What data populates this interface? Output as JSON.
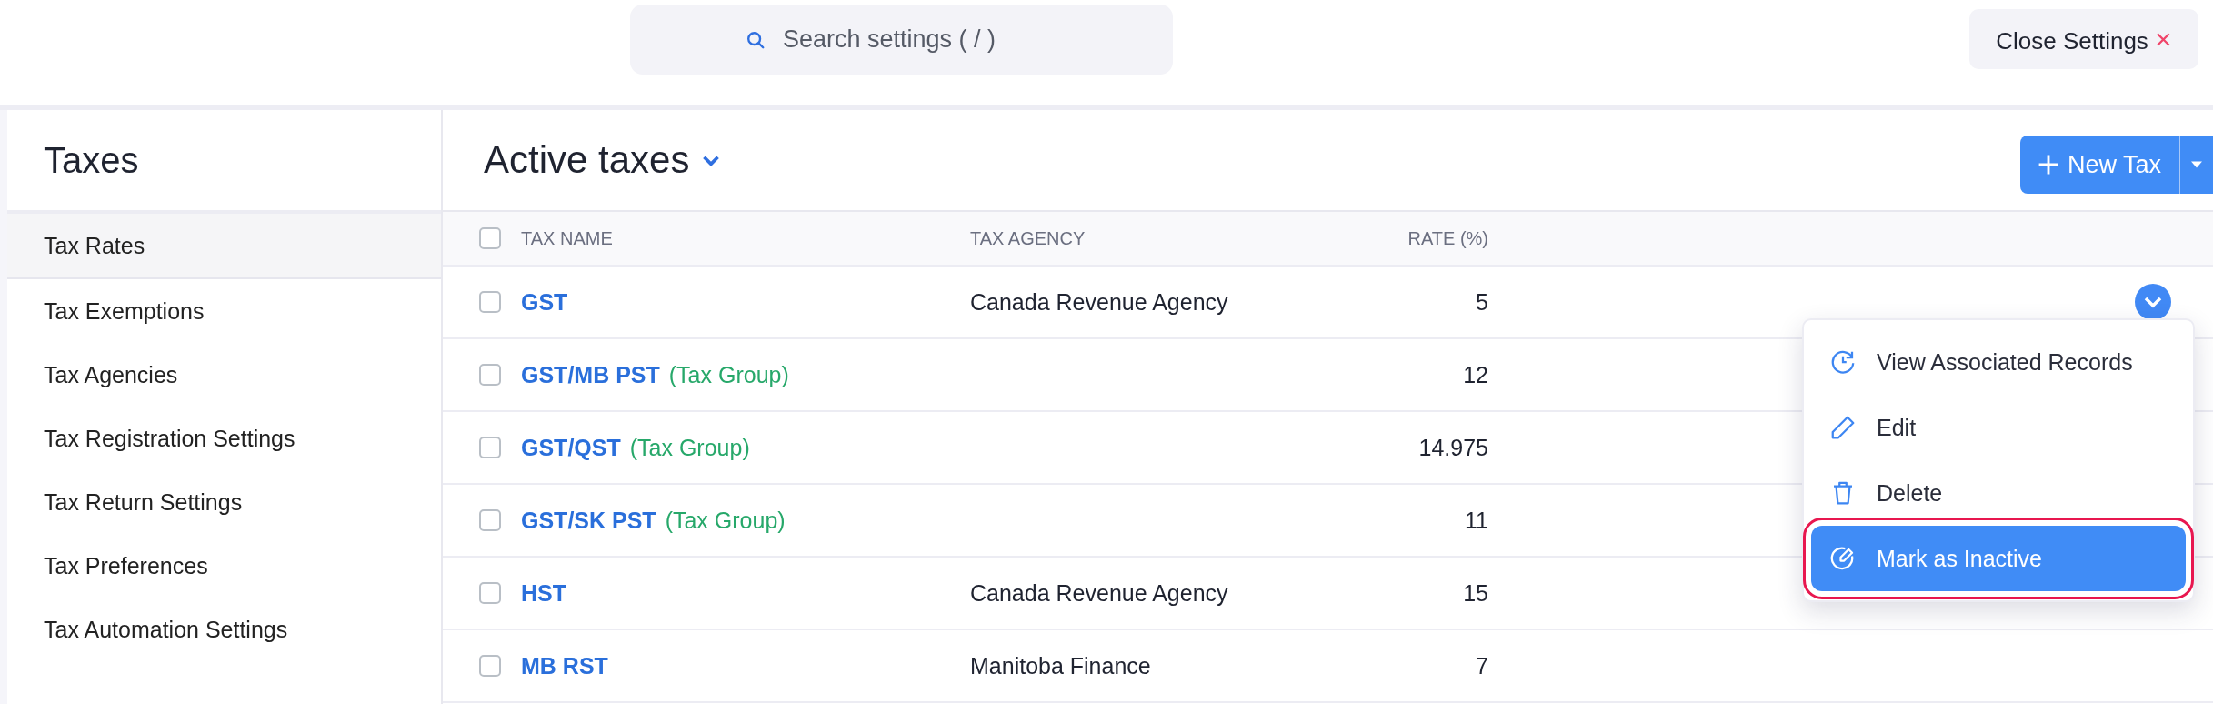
{
  "search": {
    "placeholder": "Search settings ( / )"
  },
  "close_button": {
    "label": "Close Settings",
    "icon": "×"
  },
  "sidebar": {
    "title": "Taxes",
    "items": [
      {
        "label": "Tax Rates",
        "selected": true
      },
      {
        "label": "Tax Exemptions",
        "selected": false
      },
      {
        "label": "Tax Agencies",
        "selected": false
      },
      {
        "label": "Tax Registration Settings",
        "selected": false
      },
      {
        "label": "Tax Return Settings",
        "selected": false
      },
      {
        "label": "Tax Preferences",
        "selected": false
      },
      {
        "label": "Tax Automation Settings",
        "selected": false
      }
    ]
  },
  "header": {
    "title": "Active taxes",
    "new_button": "New Tax"
  },
  "table": {
    "all_checked": false,
    "columns": [
      "TAX NAME",
      "TAX AGENCY",
      "RATE (%)"
    ],
    "rows": [
      {
        "checked": false,
        "name": "GST",
        "group": "",
        "agency": "Canada Revenue Agency",
        "rate": "5",
        "menu_open": true
      },
      {
        "checked": false,
        "name": "GST/MB PST",
        "group": "(Tax Group)",
        "agency": "",
        "rate": "12",
        "menu_open": false
      },
      {
        "checked": false,
        "name": "GST/QST",
        "group": "(Tax Group)",
        "agency": "",
        "rate": "14.975",
        "menu_open": false
      },
      {
        "checked": false,
        "name": "GST/SK PST",
        "group": "(Tax Group)",
        "agency": "",
        "rate": "11",
        "menu_open": false
      },
      {
        "checked": false,
        "name": "HST",
        "group": "",
        "agency": "Canada Revenue Agency",
        "rate": "15",
        "menu_open": false
      },
      {
        "checked": false,
        "name": "MB RST",
        "group": "",
        "agency": "Manitoba Finance",
        "rate": "7",
        "menu_open": false
      }
    ]
  },
  "row_menu": {
    "items": [
      {
        "kind": "records",
        "label": "View Associated Records",
        "selected": false,
        "highlighted": false
      },
      {
        "kind": "edit",
        "label": "Edit",
        "selected": false,
        "highlighted": false
      },
      {
        "kind": "delete",
        "label": "Delete",
        "selected": false,
        "highlighted": false
      },
      {
        "kind": "inactive",
        "label": "Mark as Inactive",
        "selected": true,
        "highlighted": true
      }
    ]
  }
}
